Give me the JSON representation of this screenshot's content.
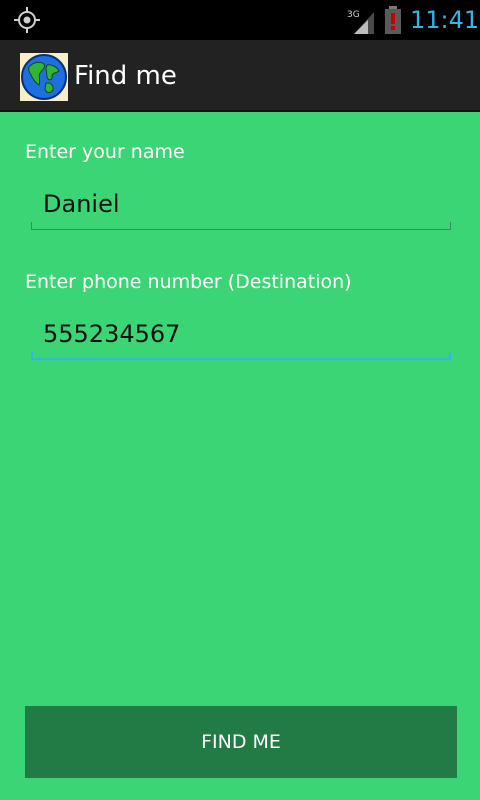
{
  "status_bar": {
    "network_type": "3G",
    "time": "11:41",
    "accent_color": "#33b5e5",
    "battery_alert_color": "#cc0000",
    "icons": [
      "gps-icon",
      "signal-icon",
      "battery-icon"
    ]
  },
  "action_bar": {
    "title": "Find me",
    "icon": "globe-icon"
  },
  "form": {
    "name_label": "Enter your name",
    "name_value": "Daniel",
    "phone_label": "Enter phone number (Destination)",
    "phone_value": "555234567",
    "button_label": "FIND ME"
  },
  "colors": {
    "background": "#3cd576",
    "button": "#227a45",
    "action_bar": "#222222"
  }
}
